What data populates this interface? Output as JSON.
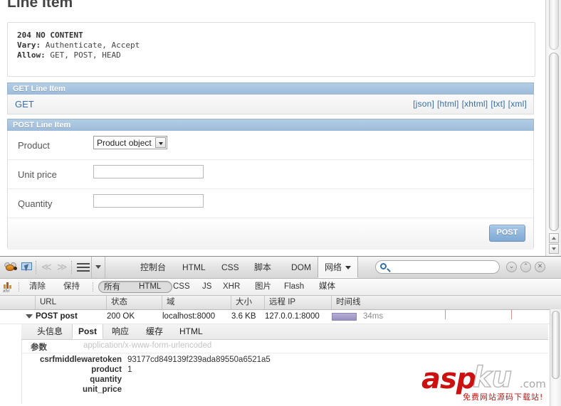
{
  "page": {
    "title": "Line Item",
    "response": {
      "status_line": "204 NO CONTENT",
      "header_vary_key": "Vary:",
      "header_vary_value": " Authenticate, Accept",
      "header_allow_key": "Allow:",
      "header_allow_value": " GET, POST, HEAD"
    },
    "get_section": {
      "header": "GET Line Item",
      "method_label": "GET",
      "formats": [
        "[json]",
        "[html]",
        "[xhtml]",
        "[txt]",
        "[xml]"
      ]
    },
    "post_section": {
      "header": "POST Line Item",
      "fields": [
        {
          "label": "Product",
          "type": "select",
          "value": "Product object"
        },
        {
          "label": "Unit price",
          "type": "text",
          "value": ""
        },
        {
          "label": "Quantity",
          "type": "text",
          "value": ""
        }
      ],
      "submit_label": "POST"
    }
  },
  "firebug": {
    "toolbar": {
      "icons": [
        "firebug-bug-icon",
        "inspector-icon",
        "prev-icon",
        "next-icon",
        "menu-icon",
        "menu-caret-icon"
      ],
      "prev_glyph": "≪",
      "next_glyph": "≫",
      "tabs": [
        {
          "label": "控制台",
          "active": false
        },
        {
          "label": "HTML",
          "active": false
        },
        {
          "label": "CSS",
          "active": false
        },
        {
          "label": "脚本",
          "active": false
        },
        {
          "label": "DOM",
          "active": false
        },
        {
          "label": "网络",
          "active": true,
          "has_caret": true
        }
      ],
      "search_placeholder": "",
      "search_value": "",
      "right_buttons": [
        {
          "name": "minimize-button",
          "glyph": "⌄"
        },
        {
          "name": "detach-button",
          "glyph": "⌃"
        },
        {
          "name": "close-button",
          "glyph": "✕"
        }
      ]
    },
    "subbar": {
      "xhr_icon_label": "xhr",
      "actions": [
        "清除",
        "保持"
      ],
      "filters": [
        {
          "label": "所有",
          "selected": true
        },
        {
          "label": "HTML",
          "selected": false
        },
        {
          "label": "CSS",
          "selected": false
        },
        {
          "label": "JS",
          "selected": false
        },
        {
          "label": "XHR",
          "selected": false
        },
        {
          "label": "图片",
          "selected": false
        },
        {
          "label": "Flash",
          "selected": false
        },
        {
          "label": "媒体",
          "selected": false
        }
      ]
    },
    "net": {
      "columns": [
        "URL",
        "状态",
        "域",
        "大小",
        "远程 IP",
        "时间线"
      ],
      "row": {
        "url": "POST post",
        "status": "200 OK",
        "domain": "localhost:8000",
        "size": "3.6 KB",
        "remote_ip": "127.0.0.1:8000",
        "time": "34ms",
        "expanded": true
      }
    },
    "detail": {
      "tabs": [
        {
          "label": "头信息",
          "active": false
        },
        {
          "label": "Post",
          "active": true
        },
        {
          "label": "响应",
          "active": false
        },
        {
          "label": "缓存",
          "active": false
        },
        {
          "label": "HTML",
          "active": false
        }
      ],
      "params_label": "参数",
      "content_type": "application/x-www-form-urlencoded",
      "params": [
        {
          "key": "csrfmiddlewaretoken",
          "value": "93177cd849139f239ada89550a6521a5"
        },
        {
          "key": "product",
          "value": "1"
        },
        {
          "key": "quantity",
          "value": ""
        },
        {
          "key": "unit_price",
          "value": ""
        }
      ]
    }
  },
  "watermark": {
    "asp": "asp",
    "ku": "ku",
    "com": ".com",
    "subtitle": "免费网站源码下载站!"
  },
  "colors": {
    "section_header": "#9dbbda",
    "link": "#3a6ea5",
    "timeline_bar": "#9a90bf",
    "watermark_red": "#cc1111"
  }
}
